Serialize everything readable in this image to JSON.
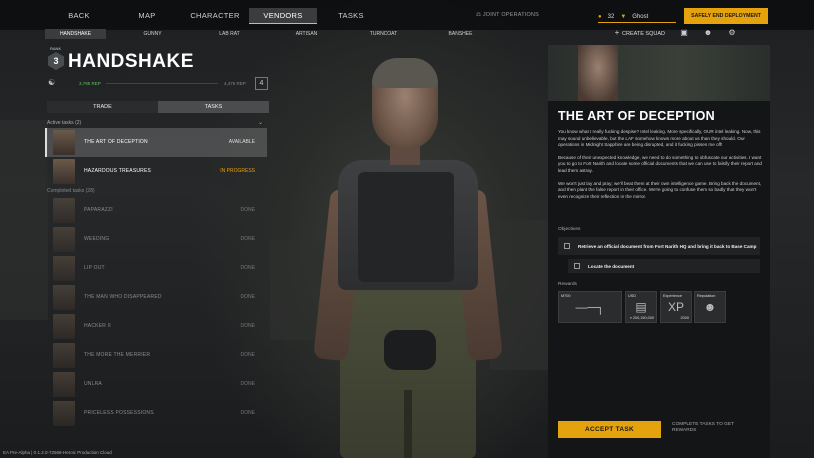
{
  "nav": {
    "tabs": [
      {
        "label": "BACK",
        "active": false
      },
      {
        "label": "MAP",
        "active": false
      },
      {
        "label": "CHARACTER",
        "active": false
      },
      {
        "label": "VENDORS",
        "active": true
      },
      {
        "label": "TASKS",
        "active": false
      }
    ],
    "joint_operations": "JOINT OPERATIONS",
    "currency_amount": "32",
    "player_name": "Ghost",
    "safely_end": "SAFELY END DEPLOYMENT",
    "create_squad": "CREATE SQUAD"
  },
  "vendor_tabs": [
    "HANDSHAKE",
    "GUNNY",
    "LAB RAT",
    "ARTISAN",
    "TURNCOAT",
    "BANSHEE"
  ],
  "vendor": {
    "rank_label": "RANK",
    "rank": "3",
    "name": "HANDSHAKE",
    "rep_current": "3,795 REP",
    "rep_next": "4,475 REP",
    "next_level": "4"
  },
  "trade_tabs": {
    "trade": "TRADE",
    "tasks": "TASKS"
  },
  "active_header": "Active tasks (2)",
  "completed_header": "Completed tasks (28)",
  "active_tasks": [
    {
      "name": "THE ART OF DECEPTION",
      "status": "AVAILABLE"
    },
    {
      "name": "HAZARDOUS TREASURES",
      "status": "IN PROGRESS"
    }
  ],
  "completed_tasks": [
    {
      "name": "PAPARAZZI",
      "status": "DONE"
    },
    {
      "name": "WEEDING",
      "status": "DONE"
    },
    {
      "name": "LIP OUT",
      "status": "DONE"
    },
    {
      "name": "THE MAN WHO DISAPPEARED",
      "status": "DONE"
    },
    {
      "name": "HACKER II",
      "status": "DONE"
    },
    {
      "name": "THE MORE THE MERRIER",
      "status": "DONE"
    },
    {
      "name": "UNLRA",
      "status": "DONE"
    },
    {
      "name": "PRICELESS POSSESSIONS",
      "status": "DONE"
    }
  ],
  "quest": {
    "title": "THE ART OF DECEPTION",
    "p1": "You know what I really fucking despise? Intel leaking. More specifically, OUR intel leaking. Now, this may sound unbelievable, but the LAF somehow knows more about us than they should. Our operations in Midnight Sapphire are being disrupted, and it fucking pisses me off!",
    "p2": "Because of their unexpected knowledge, we need to do something to obfuscate our activities. I want you to go to Fort Narith and locate some official documents that we can use to falsify their report and lead them astray.",
    "p3": "We won't just lay and pray; we'll beat them at their own intelligence game. Bring back the document, and then plant the false report in their office. We're going to confuse them so badly that they won't even recognize their reflection in the mirror.",
    "objectives_label": "Objectives",
    "objectives": [
      "Retrieve an official document from Fort Narith HQ and bring it back to Base Camp",
      "Locate the document"
    ],
    "rewards_label": "Rewards",
    "rewards": [
      {
        "title": "M700",
        "bottom": ""
      },
      {
        "title": "USD",
        "bottom": "¤ 200,150,000"
      },
      {
        "title": "Experience",
        "bottom": "2000"
      },
      {
        "title": "Reputation",
        "bottom": ""
      }
    ],
    "accept": "ACCEPT TASK",
    "accept_hint": "COMPLETE TASKS TO GET REWARDS"
  },
  "footer": "EA Pre-Alpha | 0.1.2.0-72568-Heroic Production Cloud"
}
